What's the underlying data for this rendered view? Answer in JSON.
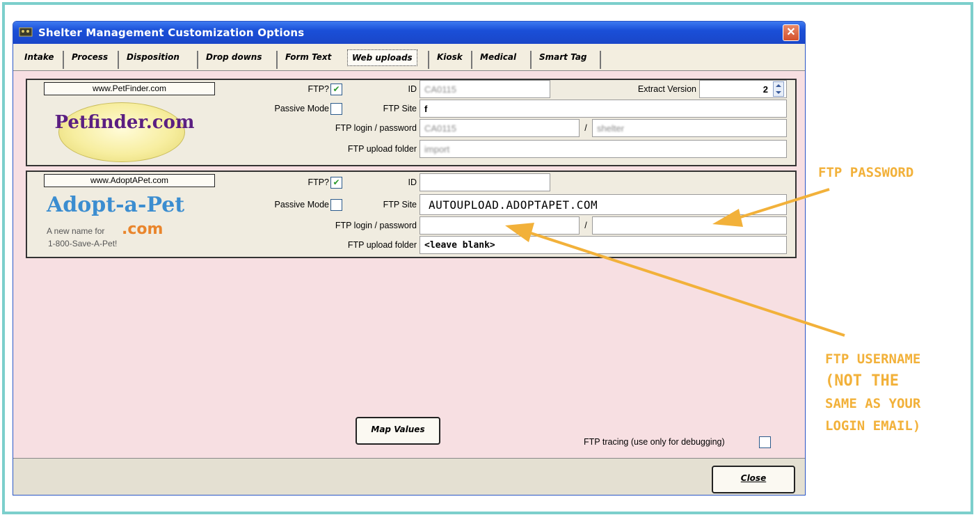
{
  "window": {
    "title": "Shelter Management Customization Options",
    "close_symbol": "✕"
  },
  "tabs": [
    {
      "label": "Intake"
    },
    {
      "label": "Process"
    },
    {
      "label": "Disposition"
    },
    {
      "label": "Drop downs"
    },
    {
      "label": "Form Text"
    },
    {
      "label": "Web uploads",
      "active": true
    },
    {
      "label": "Kiosk"
    },
    {
      "label": "Medical"
    },
    {
      "label": "Smart Tag"
    }
  ],
  "petfinder": {
    "site": "www.PetFinder.com",
    "logo_text": "Petfinder.com",
    "ftp_label": "FTP?",
    "ftp_checked": true,
    "passive_label": "Passive Mode",
    "passive_checked": false,
    "id_label": "ID",
    "id_value": "CA0115",
    "extract_label": "Extract Version",
    "extract_value": "2",
    "ftp_site_label": "FTP Site",
    "ftp_site_value": "f",
    "login_label": "FTP login / password",
    "login_value": "CA0115",
    "separator": "/",
    "password_value": "shelter",
    "folder_label": "FTP upload folder",
    "folder_value": "import"
  },
  "adoptapet": {
    "site": "www.AdoptAPet.com",
    "logo_title": "Adopt-a-Pet",
    "logo_sub1": "A new name for",
    "logo_com": ".com",
    "logo_sub2": "1-800-Save-A-Pet!",
    "ftp_label": "FTP?",
    "ftp_checked": true,
    "passive_label": "Passive Mode",
    "passive_checked": false,
    "id_label": "ID",
    "id_value": "",
    "ftp_site_label": "FTP Site",
    "ftp_site_value": "AUTOUPLOAD.ADOPTAPET.COM",
    "login_label": "FTP login / password",
    "login_value": "",
    "separator": "/",
    "password_value": "",
    "folder_label": "FTP upload folder",
    "folder_value": "<leave blank>"
  },
  "map_button": "Map Values",
  "tracing": {
    "label": "FTP tracing (use only for debugging)",
    "checked": false
  },
  "close_button": "Close",
  "annotations": {
    "password": "FTP PASSWORD",
    "username_lines": [
      "FTP USERNAME",
      "(NOT THE",
      "SAME AS YOUR",
      "LOGIN EMAIL)"
    ]
  },
  "colors": {
    "annotation": "#f2b13a",
    "frame": "#7ccfcc",
    "window_body": "#f7dfe2",
    "titlebar": "#1a4fd8"
  }
}
